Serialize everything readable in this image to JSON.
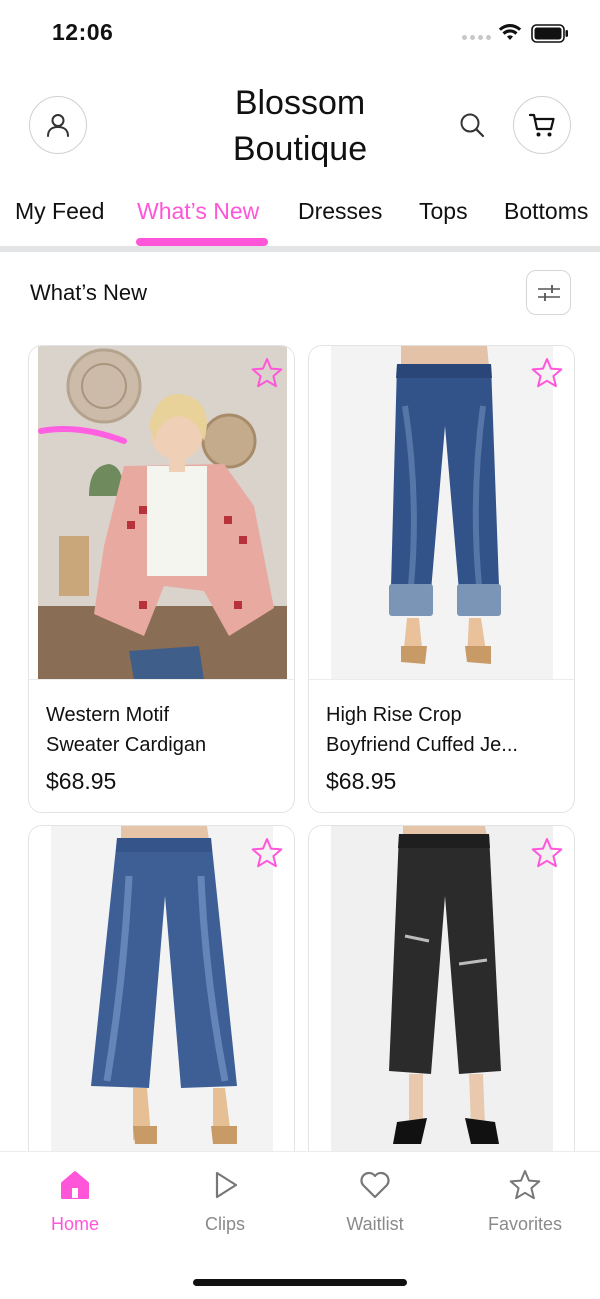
{
  "status": {
    "time": "12:06"
  },
  "header": {
    "brand_line1": "Blossom",
    "brand_line2": "Boutique"
  },
  "tabs": [
    {
      "label": "My Feed"
    },
    {
      "label": "What’s New"
    },
    {
      "label": "Dresses"
    },
    {
      "label": "Tops"
    },
    {
      "label": "Bottoms"
    }
  ],
  "active_tab": "What’s New",
  "section": {
    "title": "What’s New"
  },
  "products": [
    {
      "name_line1": "Western Motif",
      "name_line2": "Sweater Cardigan",
      "price": "$68.95"
    },
    {
      "name_line1": "High Rise Crop",
      "name_line2": "Boyfriend Cuffed Je...",
      "price": "$68.95"
    },
    {
      "name_line1": "",
      "name_line2": "",
      "price": ""
    },
    {
      "name_line1": "",
      "name_line2": "",
      "price": ""
    }
  ],
  "bottom_nav": [
    {
      "label": "Home",
      "icon": "home-icon",
      "active": true
    },
    {
      "label": "Clips",
      "icon": "play-icon",
      "active": false
    },
    {
      "label": "Waitlist",
      "icon": "heart-icon",
      "active": false
    },
    {
      "label": "Favorites",
      "icon": "star-icon",
      "active": false
    }
  ],
  "colors": {
    "accent": "#ff55d9",
    "inactive": "#8a8a8a",
    "divider": "#e2e4e6"
  }
}
